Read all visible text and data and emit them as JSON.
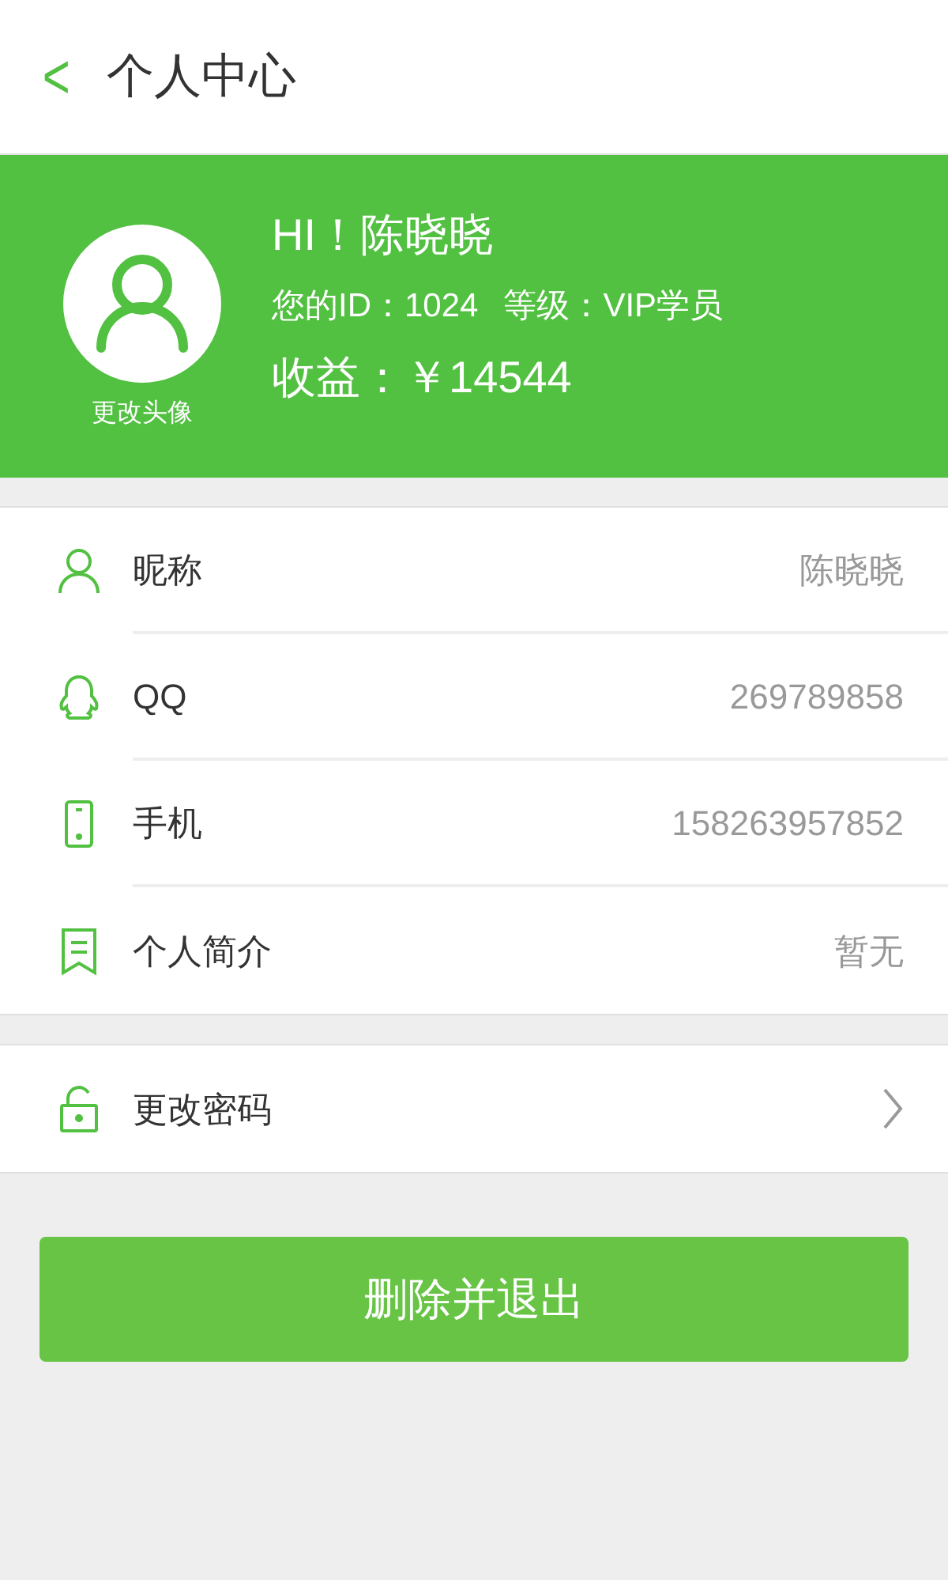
{
  "header": {
    "back": "<",
    "title": "个人中心"
  },
  "profile": {
    "avatar_caption": "更改头像",
    "greeting": "HI！陈晓晓",
    "id_text": "您的ID：1024",
    "level_text": "等级：VIP学员",
    "earnings": "收益：￥14544"
  },
  "info_rows": [
    {
      "kind": "person",
      "label": "昵称",
      "value": "陈晓晓"
    },
    {
      "kind": "qq",
      "label": "QQ",
      "value": "269789858"
    },
    {
      "kind": "phone",
      "label": "手机",
      "value": "158263957852"
    },
    {
      "kind": "bookmark",
      "label": "个人简介",
      "value": "暂无"
    }
  ],
  "security_rows": [
    {
      "kind": "lock",
      "label": "更改密码"
    }
  ],
  "action_button": "删除并退出"
}
